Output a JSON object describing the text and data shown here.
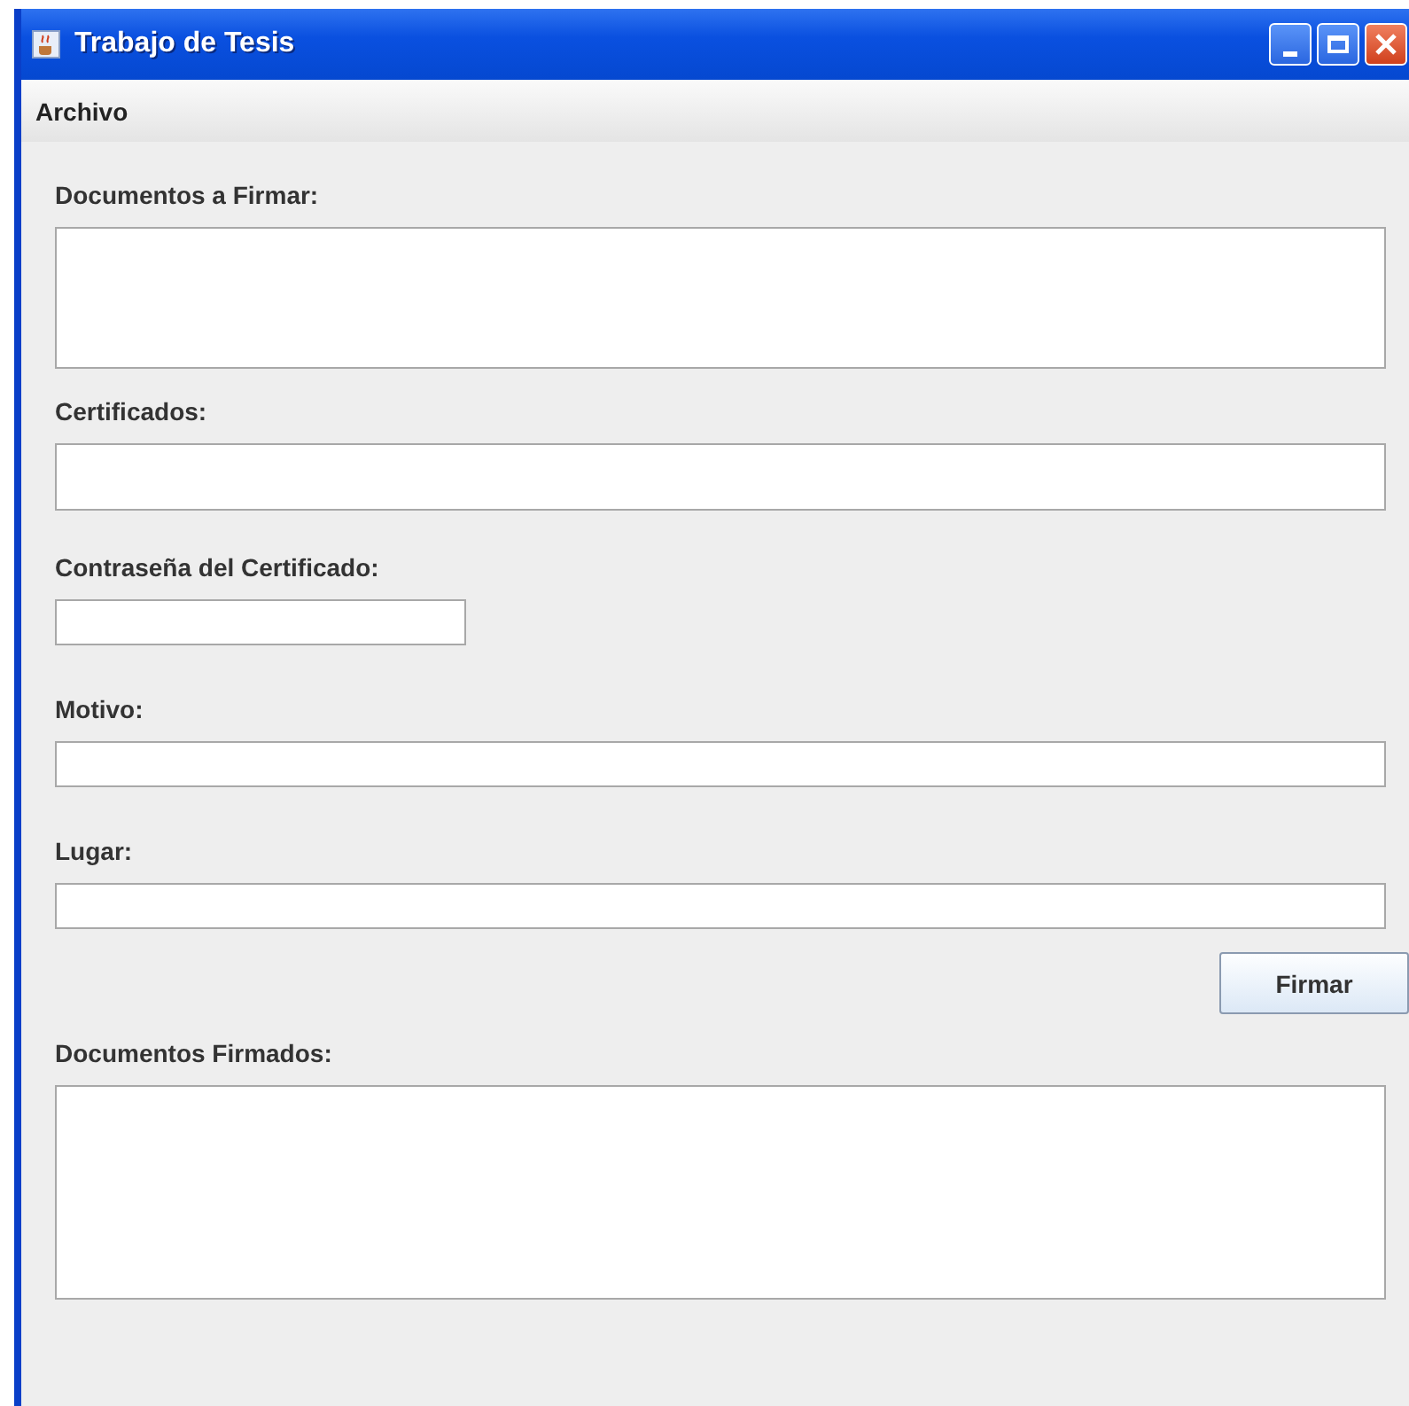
{
  "window": {
    "title": "Trabajo de Tesis"
  },
  "menu": [
    "Archivo"
  ],
  "form": [
    {
      "kind": "list",
      "label": "Documentos a Firmar:"
    },
    {
      "kind": "combo",
      "label": "Certificados:"
    },
    {
      "kind": "password",
      "label": "Contraseña del Certificado:"
    },
    {
      "kind": "text",
      "label": "Motivo:"
    },
    {
      "kind": "text",
      "label": "Lugar:"
    },
    {
      "kind": "button",
      "label": "Firmar"
    },
    {
      "kind": "result",
      "label": "Documentos Firmados:"
    }
  ]
}
